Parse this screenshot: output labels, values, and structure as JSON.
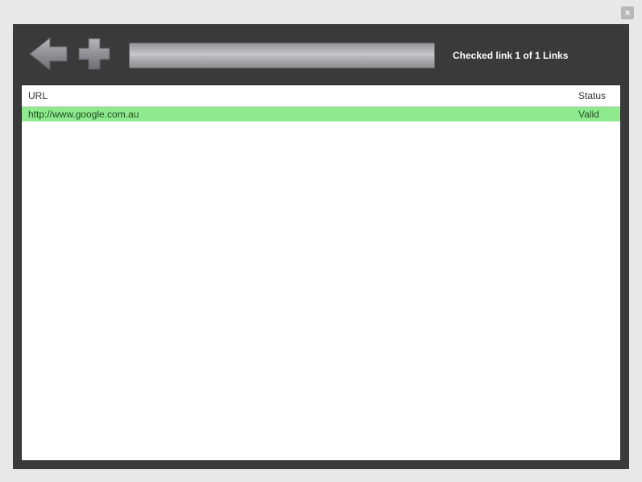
{
  "toolbar": {
    "status": "Checked link 1 of 1 Links"
  },
  "table": {
    "headers": {
      "url": "URL",
      "status": "Status"
    },
    "rows": [
      {
        "url": "http://www.google.com.au",
        "status": "Valid"
      }
    ]
  }
}
